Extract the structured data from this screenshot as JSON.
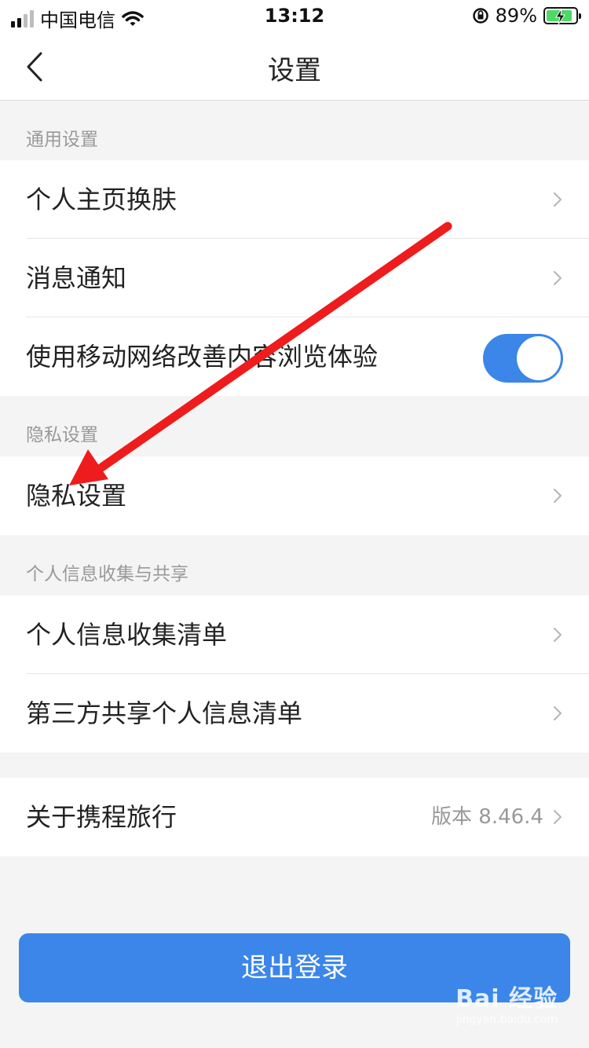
{
  "status_bar": {
    "carrier": "中国电信",
    "time": "13:12",
    "battery_percent": "89%",
    "battery_level": 0.89
  },
  "nav": {
    "title": "设置",
    "back_icon": "chevron-left-icon"
  },
  "sections": {
    "general": {
      "header": "通用设置",
      "items": [
        {
          "label": "个人主页换肤"
        },
        {
          "label": "消息通知"
        },
        {
          "label": "使用移动网络改善内容浏览体验",
          "toggle_on": true
        }
      ]
    },
    "privacy": {
      "header": "隐私设置",
      "items": [
        {
          "label": "隐私设置"
        }
      ]
    },
    "personal_info": {
      "header": "个人信息收集与共享",
      "items": [
        {
          "label": "个人信息收集清单"
        },
        {
          "label": "第三方共享个人信息清单"
        }
      ]
    },
    "about": {
      "label": "关于携程旅行",
      "version": "版本 8.46.4"
    }
  },
  "logout_label": "退出登录",
  "watermark": {
    "main": "Bai 经验",
    "sub": "jingyan.baidu.com"
  },
  "colors": {
    "accent": "#3b86e8",
    "annotation_arrow": "#ee1c1c",
    "background": "#f4f4f4"
  }
}
